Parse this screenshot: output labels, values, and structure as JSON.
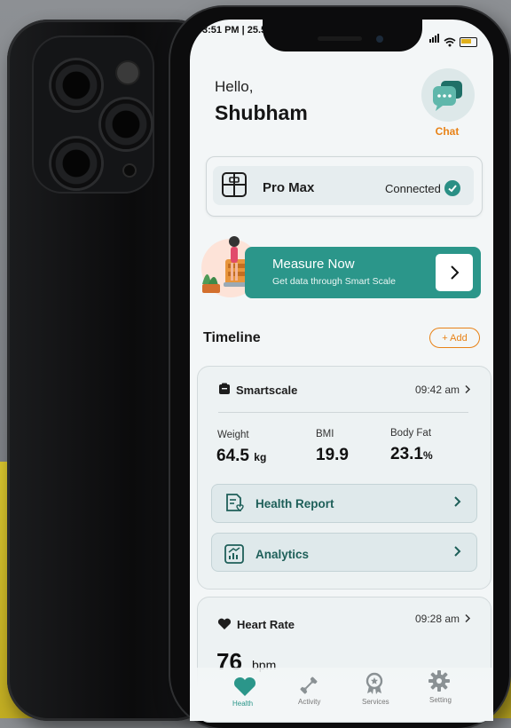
{
  "status": {
    "time": "3:51 PM | 25.5"
  },
  "header": {
    "greeting": "Hello,",
    "user_name": "Shubham",
    "chat_label": "Chat"
  },
  "device": {
    "name": "Pro Max",
    "status": "Connected"
  },
  "measure": {
    "title": "Measure Now",
    "subtitle": "Get data through Smart Scale"
  },
  "timeline": {
    "title": "Timeline",
    "add_label": "+ Add"
  },
  "smartscale": {
    "title": "Smartscale",
    "time": "09:42 am",
    "metrics": [
      {
        "label": "Weight",
        "value": "64.5",
        "unit": "kg"
      },
      {
        "label": "BMI",
        "value": "19.9",
        "unit": ""
      },
      {
        "label": "Body Fat",
        "value": "23.1",
        "unit": "%"
      }
    ],
    "health_report_label": "Health Report",
    "analytics_label": "Analytics"
  },
  "heart_rate": {
    "title": "Heart Rate",
    "time": "09:28 am",
    "value": "76",
    "unit": "bpm"
  },
  "tabs": [
    {
      "label": "Health",
      "icon": "heart-icon"
    },
    {
      "label": "Activity",
      "icon": "dumbbell-icon"
    },
    {
      "label": "Services",
      "icon": "badge-icon"
    },
    {
      "label": "Setting",
      "icon": "gear-icon"
    }
  ],
  "colors": {
    "accent": "#2b968a",
    "orange": "#e88217",
    "screen_bg": "#f3f6f7"
  }
}
